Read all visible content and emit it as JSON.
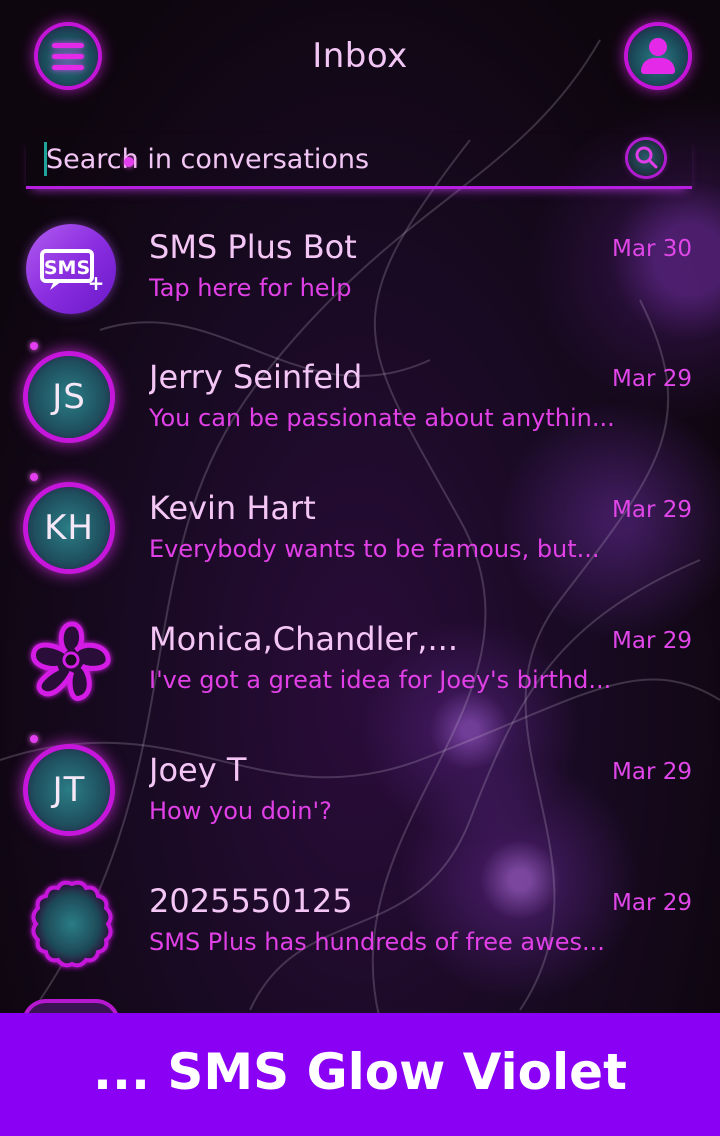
{
  "header": {
    "title": "Inbox",
    "menu_icon": "hamburger-menu-icon",
    "profile_icon": "person-icon"
  },
  "search": {
    "placeholder": "Search in conversations",
    "icon": "search-icon"
  },
  "conversations": [
    {
      "name": "SMS Plus Bot",
      "date": "Mar 30",
      "preview": "Tap here for help",
      "avatar": "sms-plus-logo-icon",
      "unread": false
    },
    {
      "name": "Jerry Seinfeld",
      "date": "Mar 29",
      "preview": "You can be passionate about anythin...",
      "initials": "JS",
      "unread": true
    },
    {
      "name": "Kevin Hart",
      "date": "Mar 29",
      "preview": "Everybody wants to be famous, but...",
      "initials": "KH",
      "unread": false
    },
    {
      "name": "Monica,Chandler,...",
      "date": "Mar 29",
      "preview": "I've got a great idea for Joey's birthd...",
      "avatar": "group-flower-icon",
      "unread": false
    },
    {
      "name": "Joey T",
      "date": "Mar 29",
      "preview": "How you doin'?",
      "initials": "JT",
      "unread": false
    },
    {
      "name": "2025550125",
      "date": "Mar 29",
      "preview": "SMS Plus has hundreds of free awes...",
      "avatar": "scalloped-contact-icon",
      "unread": false
    }
  ],
  "footer": {
    "banner": "... SMS Glow Violet"
  },
  "colors": {
    "accent": "#c616dc",
    "text": "#f4c6f5",
    "preview": "#e040e6",
    "banner": "#8a00f5"
  }
}
